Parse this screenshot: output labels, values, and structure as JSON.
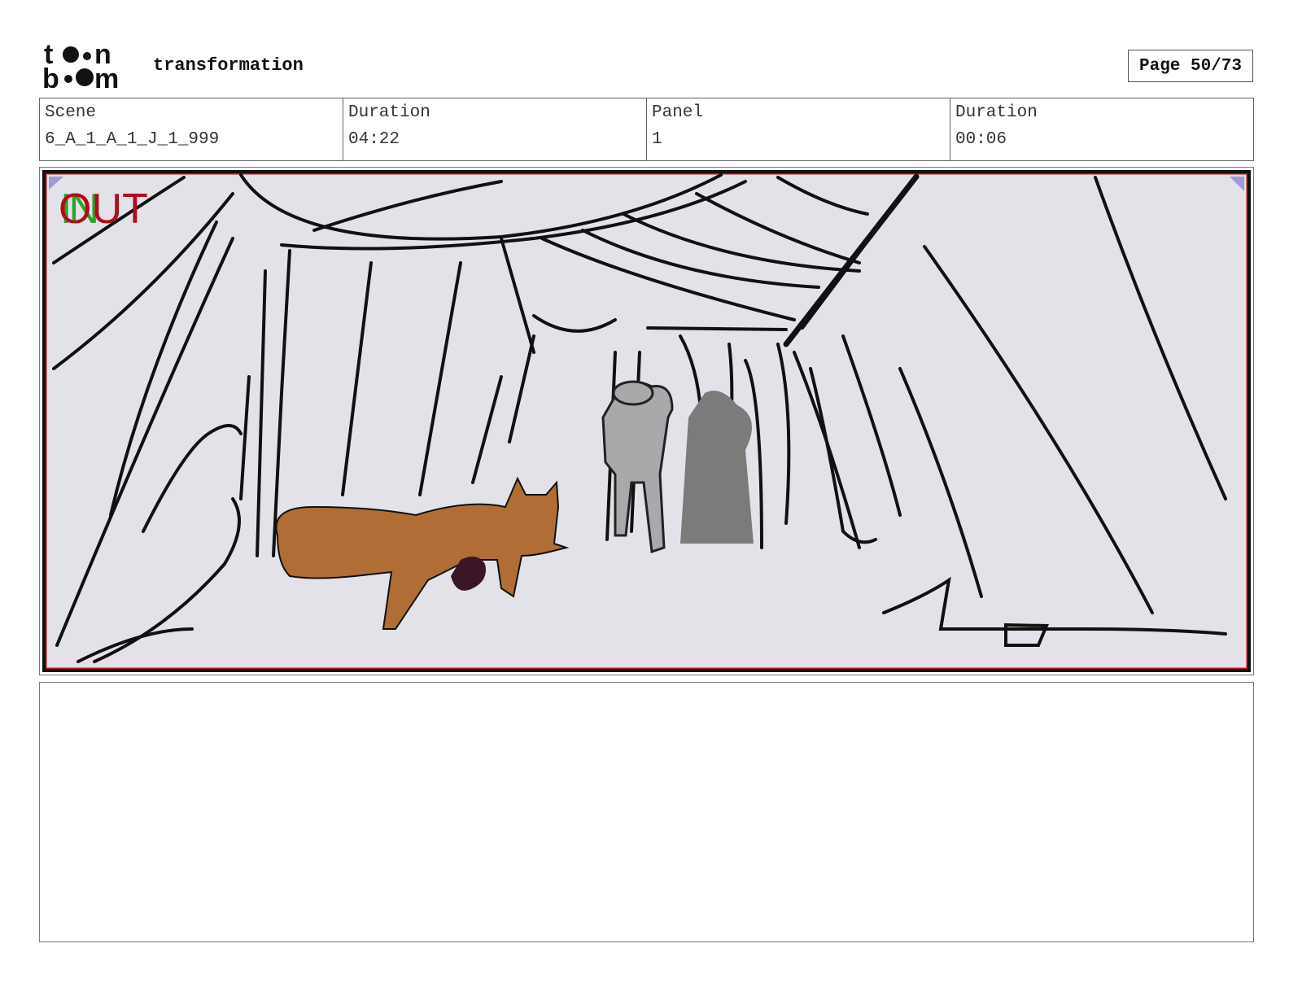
{
  "header": {
    "logo_alt": "toon boom",
    "title": "transformation",
    "page": "Page 50/73"
  },
  "info": {
    "scene_label": "Scene",
    "scene_value": "6_A_1_A_1_J_1_999",
    "duration_label": "Duration",
    "duration_value": "04:22",
    "panel_label": "Panel",
    "panel_value": "1",
    "panel_duration_label": "Duration",
    "panel_duration_value": "00:06"
  },
  "panel_image": {
    "in_marker": "IN",
    "out_marker": "OUT",
    "colors": {
      "background": "#e3e2e8",
      "fox": "#b06d36",
      "border": "#c0141c",
      "in": "#2aa52a",
      "out": "#b00d1a"
    }
  },
  "notes": {
    "text": ""
  }
}
